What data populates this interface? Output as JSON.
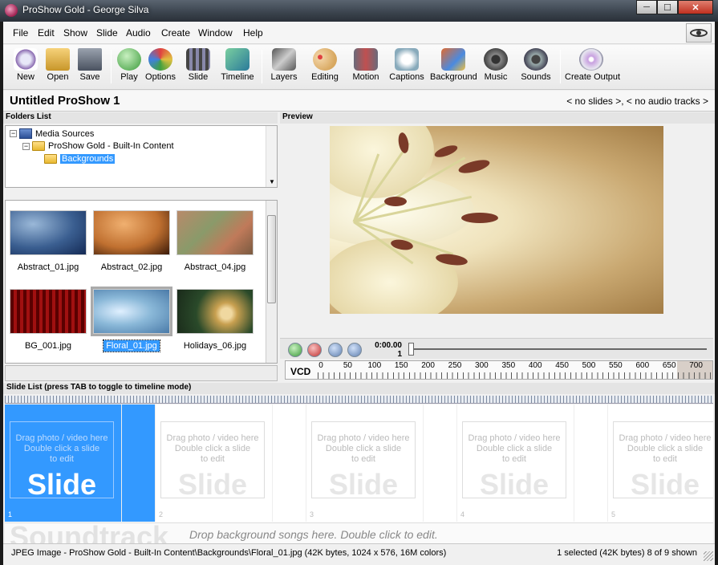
{
  "window": {
    "title": "ProShow Gold - George Silva",
    "min": "─",
    "max": "☐",
    "close": "✕"
  },
  "menu": [
    "File",
    "Edit",
    "Show",
    "Slide",
    "Audio",
    "Create",
    "Window",
    "Help"
  ],
  "toolbar": [
    "New",
    "Open",
    "Save",
    "Play",
    "Options",
    "Slide",
    "Timeline",
    "Layers",
    "Editing",
    "Motion",
    "Captions",
    "Background",
    "Music",
    "Sounds",
    "Create Output"
  ],
  "project": {
    "title": "Untitled ProShow 1",
    "status": "< no slides >, < no audio tracks >"
  },
  "folders": {
    "header": "Folders List",
    "tree": [
      "Media Sources",
      "ProShow Gold - Built-In Content",
      "Backgrounds"
    ],
    "collapse": "−",
    "arrow_down": "▼"
  },
  "thumbnails": [
    "Abstract_01.jpg",
    "Abstract_02.jpg",
    "Abstract_04.jpg",
    "BG_001.jpg",
    "Floral_01.jpg",
    "Holidays_06.jpg"
  ],
  "preview": {
    "header": "Preview",
    "time": "0:00.00",
    "frame": "1"
  },
  "ruler": {
    "format": "VCD",
    "ticks": [
      "0",
      "50",
      "100",
      "150",
      "200",
      "250",
      "300",
      "350",
      "400",
      "450",
      "500",
      "550",
      "600",
      "650",
      "700"
    ]
  },
  "slidelist": {
    "header": "Slide List (press TAB to toggle to timeline mode)",
    "hint1": "Drag photo / video here",
    "hint2": "Double click a slide",
    "hint3": "to edit",
    "big": "Slide",
    "numbers": [
      "1",
      "2",
      "3",
      "4",
      "5"
    ]
  },
  "soundtrack": {
    "title": "Soundtrack",
    "hint": "Drop background songs here.  Double click to edit."
  },
  "statusbar": {
    "left": "JPEG Image - ProShow Gold - Built-In Content\\Backgrounds\\Floral_01.jpg  (42K bytes, 1024 x 576, 16M colors)",
    "right": "1 selected (42K bytes) 8 of 9 shown"
  }
}
